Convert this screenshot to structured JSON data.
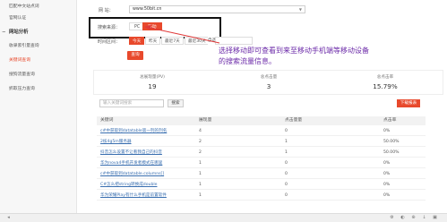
{
  "sidebar": {
    "items": [
      {
        "label": "匹配中文站点词",
        "kind": "sub"
      },
      {
        "label": "官网认证",
        "kind": "sub"
      },
      {
        "label": "网站分析",
        "kind": "section"
      },
      {
        "label": "收录索引量查询",
        "kind": "sub"
      },
      {
        "label": "关键词查询",
        "kind": "active"
      },
      {
        "label": "搜狗流量查询",
        "kind": "sub"
      },
      {
        "label": "抓取压力查询",
        "kind": "sub"
      }
    ]
  },
  "filters": {
    "site_label": "网 站：",
    "site_value": "www.50bit.cn",
    "source_label": "搜索来源：",
    "source_pc": "PC",
    "source_mobile": "移动",
    "time_label": "时间区间：",
    "time_options": [
      "今天",
      "昨天",
      "最近7天",
      "最近30天",
      "自选"
    ],
    "query_button": "查询"
  },
  "annotation": "选择移动即可查看到来至移动手机端等移动设备的搜索流量信息。",
  "stats": [
    {
      "label": "总展现量(PV)",
      "value": "19"
    },
    {
      "label": "总点击量",
      "value": "3"
    },
    {
      "label": "总点击率",
      "value": "15.79%"
    }
  ],
  "search": {
    "placeholder": "输入关键词搜索",
    "button": "搜索",
    "download": "下载报表"
  },
  "table": {
    "headers": [
      "关键词",
      "展现量",
      "点击量量",
      "点击率"
    ],
    "rows": [
      {
        "keyword": "c#中获取到datatable第一列的列名",
        "pv": "4",
        "clicks": "0",
        "ctr": "0%"
      },
      {
        "keyword": "2核4g5m服务器",
        "pv": "2",
        "clicks": "1",
        "ctr": "50.00%"
      },
      {
        "keyword": "抖音怎么设置不让看我自己的抖音",
        "pv": "2",
        "clicks": "1",
        "ctr": "50.00%"
      },
      {
        "keyword": "华为nova4手机开发者模式在哪里",
        "pv": "1",
        "clicks": "0",
        "ctr": "0%"
      },
      {
        "keyword": "c#中获取到datatable.columns[]",
        "pv": "1",
        "clicks": "0",
        "ctr": "0%"
      },
      {
        "keyword": "C#怎么把string转换成double",
        "pv": "1",
        "clicks": "0",
        "ctr": "0%"
      },
      {
        "keyword": "华为荣耀Play有什么手机是前置软件",
        "pv": "1",
        "clicks": "0",
        "ctr": "0%"
      }
    ]
  },
  "colors": {
    "accent": "#e8492c",
    "annotation": "#6b2aa8",
    "link": "#3a6fb0"
  }
}
